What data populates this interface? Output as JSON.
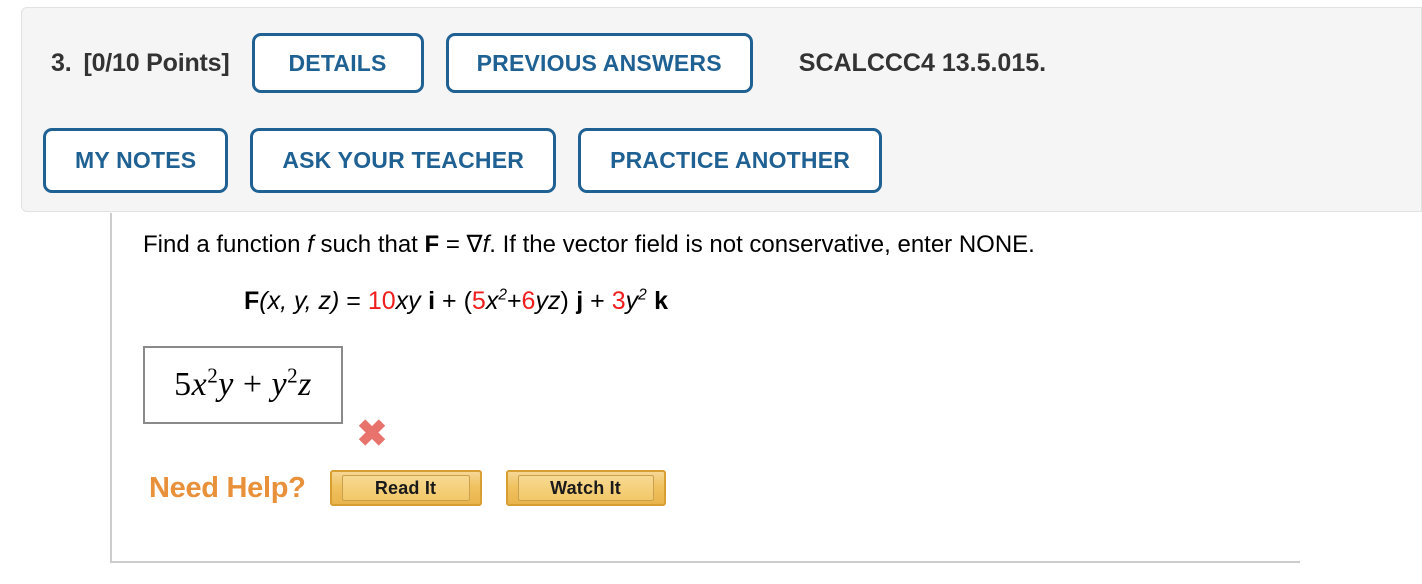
{
  "header": {
    "question_number": "3.",
    "points": "[0/10 Points]",
    "module_id": "SCALCCC4 13.5.015.",
    "buttons_row1": [
      {
        "label": "DETAILS",
        "name": "details-button"
      },
      {
        "label": "PREVIOUS ANSWERS",
        "name": "previous-answers-button"
      }
    ],
    "buttons_row2": [
      {
        "label": "MY NOTES",
        "name": "my-notes-button"
      },
      {
        "label": "ASK YOUR TEACHER",
        "name": "ask-your-teacher-button"
      },
      {
        "label": "PRACTICE ANOTHER",
        "name": "practice-another-button"
      }
    ]
  },
  "question": {
    "prompt": {
      "part1": "Find a function ",
      "f1": "f",
      "part2": " such that ",
      "Fbold": "F",
      "part3": " = ",
      "grad": "∇",
      "f2": "f",
      "part4": ". If the vector field is not conservative, enter NONE."
    },
    "formula": {
      "F": "F",
      "args": "(x, y, z)",
      "equals": " = ",
      "term1_coef": "10",
      "term1_vars": "xy",
      "i": "i",
      "plus1": " + ",
      "open_paren": "(",
      "term2a_coef": "5",
      "term2a_var": "x",
      "term2a_exp": "2",
      "plus_inner": "+",
      "term2b_coef": "6",
      "term2b_vars": "yz",
      "close_paren": ")",
      "j": "j",
      "plus2": " + ",
      "term3_coef": "3",
      "term3_var": "y",
      "term3_exp": "2",
      "k": "k"
    },
    "answer": {
      "value_coef": "5",
      "value_x": "x",
      "value_x_exp": "2",
      "value_y": "y",
      "value_plus": " + ",
      "value_y2": "y",
      "value_y2_exp": "2",
      "value_z": "z",
      "placeholder": ""
    },
    "grading": {
      "mark": "✖",
      "status": "incorrect"
    },
    "help": {
      "label": "Need Help?",
      "read_it": "Read It",
      "watch_it": "Watch It"
    }
  },
  "colors": {
    "accent_blue": "#1f6193",
    "red": "#f01d1d",
    "orange": "#e8903a",
    "wrong_mark": "#e8726c",
    "gold": "#f0c260"
  }
}
